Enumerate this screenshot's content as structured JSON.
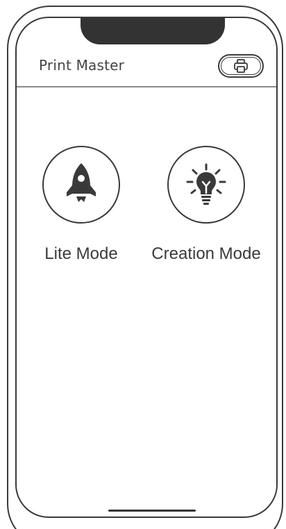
{
  "app": {
    "title": "Print Master"
  },
  "header": {
    "print_button_icon": "printer-icon"
  },
  "modes": [
    {
      "label": "Lite Mode",
      "icon": "rocket-icon"
    },
    {
      "label": "Creation Mode",
      "icon": "lightbulb-icon"
    }
  ],
  "colors": {
    "outline": "#3a3a3a",
    "notch": "#333333",
    "divider": "#8a8a8a",
    "text": "#3a3a3a",
    "background": "#ffffff"
  }
}
